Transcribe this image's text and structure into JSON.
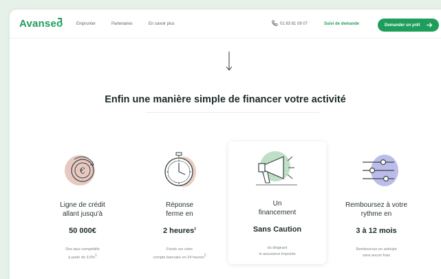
{
  "header": {
    "logo": "Avanseo",
    "nav": [
      "Emprunter",
      "Partenaires",
      "En savoir plus"
    ],
    "phone": "01 83 81 09 07",
    "suivi": "Suivi de demande",
    "cta": "Demander un prêt"
  },
  "headline": "Enfin une manière simple de financer votre activité",
  "features": [
    {
      "title_1": "Ligne de crédit",
      "title_2": "allant jusqu'à",
      "value": "50 000€",
      "sub_1": "Des taux compétitifs",
      "sub_2": "à partir de 3,0%",
      "sup": "1",
      "blob_color": "#e8c9c1",
      "icon": "euro-refresh-icon"
    },
    {
      "title_1": "Réponse",
      "title_2": "ferme en",
      "value": "2 heures",
      "value_sup": "2",
      "sub_1": "Fonds sur votre",
      "sub_2": "compte bancaire en 24 heures",
      "sup": "2",
      "blob_color": "#e9cfc4",
      "icon": "stopwatch-icon"
    },
    {
      "title_1": "Un",
      "title_2": "financement",
      "value": "Sans Caution",
      "sub_1": "du dirigeant",
      "sub_2": "ni assurance imposée",
      "blob_color": "#bfe0c7",
      "icon": "megaphone-icon"
    },
    {
      "title_1": "Remboursez à votre",
      "title_2": "rythme en",
      "value": "3 à 12 mois",
      "sub_1": "Remboursez en anticipé",
      "sub_2": "sans aucun frais",
      "blob_color": "#bcbcea",
      "icon": "sliders-icon"
    }
  ],
  "colors": {
    "brand": "#1e9e5a",
    "text": "#1d2a2a"
  }
}
